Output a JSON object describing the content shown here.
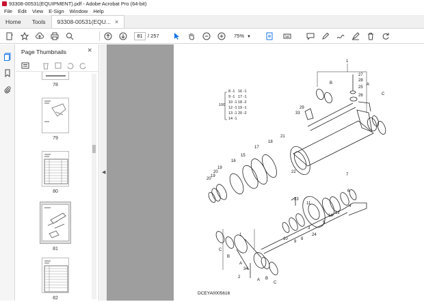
{
  "window": {
    "title": "93308-00531(EQUIPMENT).pdf - Adobe Acrobat Pro (64-bit)"
  },
  "menu": [
    "File",
    "Edit",
    "View",
    "E-Sign",
    "Window",
    "Help"
  ],
  "tabs": {
    "home": "Home",
    "tools": "Tools",
    "doc": "93308-00531(EQU..."
  },
  "toolbar": {
    "current_page": "81",
    "total_pages": "/ 257",
    "zoom": "75%"
  },
  "thumbnails": {
    "title": "Page Thumbnails",
    "labels": [
      "78",
      "79",
      "80",
      "81",
      "82"
    ]
  },
  "drawing": {
    "caption": "DCEYA0005616",
    "legend": [
      "8 -1",
      "9 -1",
      "10 -1",
      "12 -1",
      "13 -1",
      "14 -1",
      "16 -1",
      "17 -1",
      "18 -2",
      "19 -1",
      "20 -2",
      "100"
    ],
    "callouts": [
      "1",
      "27",
      "28",
      "25",
      "26",
      "A",
      "B",
      "C",
      "29",
      "33",
      "21",
      "18",
      "17",
      "15",
      "16",
      "19",
      "20",
      "22",
      "20",
      "19",
      "23",
      "11",
      "24",
      "3",
      "5",
      "14",
      "12",
      "4",
      "6",
      "7",
      "8",
      "9",
      "10",
      "1",
      "C",
      "B",
      "A",
      "34",
      "2",
      "A",
      "B",
      "C"
    ]
  },
  "colors": {
    "accent": "#1473e6",
    "brand": "#c8102e",
    "doc_bg": "#9e9e9e"
  }
}
